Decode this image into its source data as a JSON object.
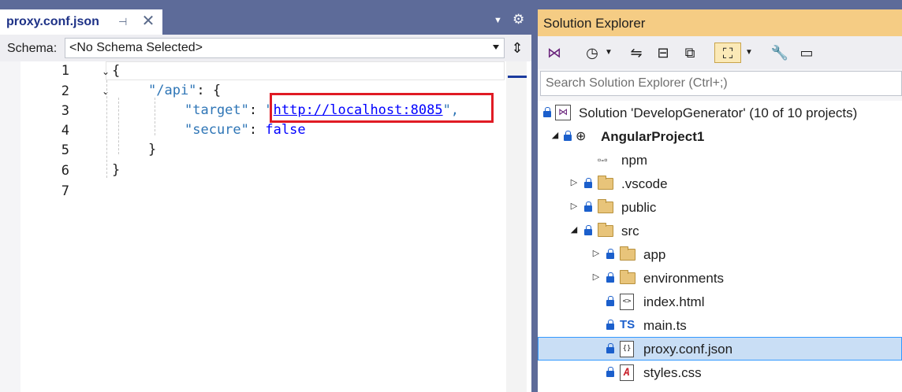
{
  "editor": {
    "tab_title": "proxy.conf.json",
    "schema_label": "Schema:",
    "schema_value": "<No Schema Selected>",
    "line_numbers": [
      "1",
      "2",
      "3",
      "4",
      "5",
      "6",
      "7"
    ],
    "code": {
      "l1": "{",
      "l2_key": "\"/api\"",
      "l2_rest": ": {",
      "l3_key": "\"target\"",
      "l3_colon": ": ",
      "l3_quote_open": "\"",
      "l3_url": "http://localhost:8085",
      "l3_quote_close": "\",",
      "l4_key": "\"secure\"",
      "l4_colon": ": ",
      "l4_value": "false",
      "l5": "}",
      "l6": "}"
    }
  },
  "solution_explorer": {
    "title": "Solution Explorer",
    "search_placeholder": "Search Solution Explorer (Ctrl+;)",
    "tree": [
      {
        "label": "Solution 'DevelopGenerator' (10 of 10 projects)"
      },
      {
        "label": "AngularProject1"
      },
      {
        "label": "npm"
      },
      {
        "label": ".vscode"
      },
      {
        "label": "public"
      },
      {
        "label": "src"
      },
      {
        "label": "app"
      },
      {
        "label": "environments"
      },
      {
        "label": "index.html"
      },
      {
        "label": "main.ts"
      },
      {
        "label": "proxy.conf.json"
      },
      {
        "label": "styles.css"
      }
    ],
    "icons": {
      "ts_icon_text": "TS",
      "npm_icon_text": "▫-▫"
    }
  },
  "colors": {
    "accent": "#5d6b99",
    "explorer_title": "#f5cc84",
    "highlight": "#e01b24",
    "selection": "#c9def5"
  }
}
